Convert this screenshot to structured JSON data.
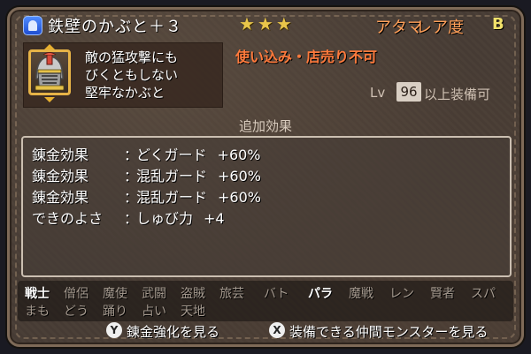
{
  "header": {
    "type_icon": "helmet-type-icon",
    "item_name": "鉄壁のかぶと＋３",
    "stars": "★★★",
    "slot": "アタマ",
    "rarity_label": "レア度",
    "rarity_value": "B"
  },
  "item": {
    "icon": "helmet-icon",
    "description": [
      "敵の猛攻撃にも",
      "びくともしない",
      "堅牢なかぶと"
    ],
    "warning": "使い込み・店売り不可",
    "level": {
      "prefix": "Lv",
      "value": "96",
      "suffix": "以上装備可"
    }
  },
  "effects": {
    "title": "追加効果",
    "rows": [
      {
        "label": "錬金効果",
        "colon": "：",
        "name": "どくガード",
        "value": "+60%"
      },
      {
        "label": "錬金効果",
        "colon": "：",
        "name": "混乱ガード",
        "value": "+60%"
      },
      {
        "label": "錬金効果",
        "colon": "：",
        "name": "混乱ガード",
        "value": "+60%"
      },
      {
        "label": "できのよさ",
        "colon": "：",
        "name": "しゅび力",
        "value": "+4"
      }
    ]
  },
  "jobs": {
    "row1": [
      {
        "label": "戦士",
        "active": true
      },
      {
        "label": "僧侶",
        "active": false
      },
      {
        "label": "魔使",
        "active": false
      },
      {
        "label": "武闘",
        "active": false
      },
      {
        "label": "盗賊",
        "active": false
      },
      {
        "label": "旅芸",
        "active": false
      },
      {
        "label": "バト",
        "active": false
      },
      {
        "label": "パラ",
        "active": true
      },
      {
        "label": "魔戦",
        "active": false
      },
      {
        "label": "レン",
        "active": false
      },
      {
        "label": "賢者",
        "active": false
      },
      {
        "label": "スパ",
        "active": false
      }
    ],
    "row2": [
      {
        "label": "まも",
        "active": false
      },
      {
        "label": "どう",
        "active": false
      },
      {
        "label": "踊り",
        "active": false
      },
      {
        "label": "占い",
        "active": false
      },
      {
        "label": "天地",
        "active": false
      }
    ]
  },
  "footer": {
    "y_button": "Y",
    "y_label": "錬金強化を見る",
    "x_button": "X",
    "x_label": "装備できる仲間モンスターを見る"
  },
  "colors": {
    "panel": "#4a3f37",
    "item_name": "#ffffff",
    "stars": "#e9c64a",
    "slot_rarity": "#ff9f58",
    "warning": "#ff7a3c",
    "job_active": "#ffffff",
    "job_inactive": "#a59a8f"
  }
}
